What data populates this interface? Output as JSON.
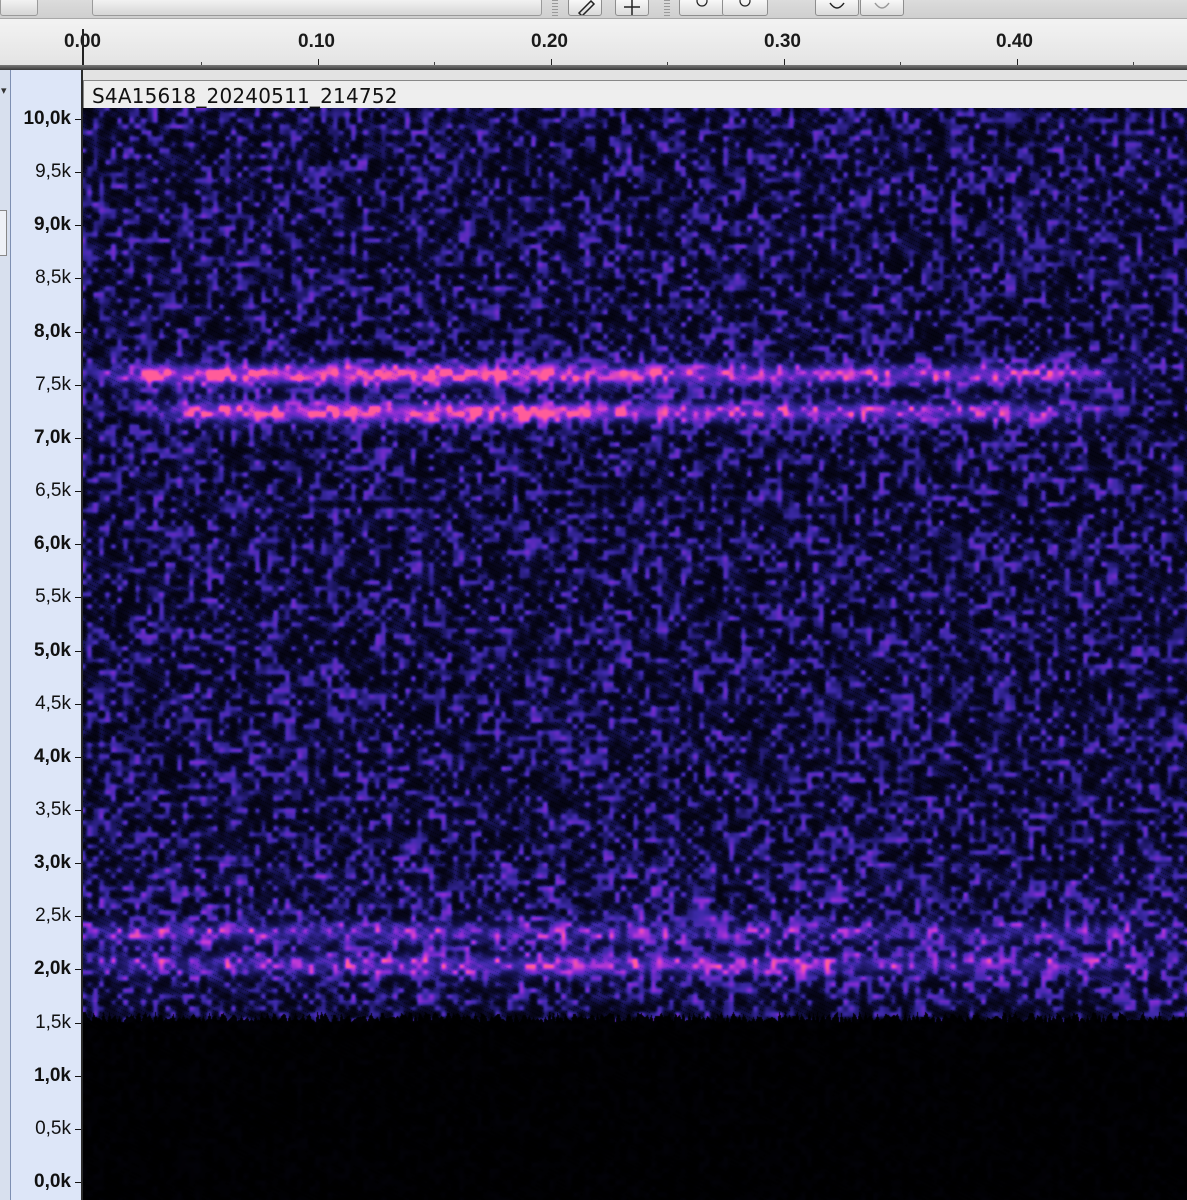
{
  "app": {
    "track_name": "S4A15618_20240511_214752"
  },
  "toolbar": {
    "icons": [
      "draw-tool-icon",
      "multi-tool-icon",
      "zoom-in-icon",
      "zoom-out-icon",
      "undo-icon",
      "redo-icon"
    ]
  },
  "timeline": {
    "ticks": [
      "0.00",
      "0.10",
      "0.20",
      "0.30",
      "0.40"
    ]
  },
  "frequency_axis": {
    "labels": [
      "10,0k",
      "9,5k",
      "9,0k",
      "8,5k",
      "8,0k",
      "7,5k",
      "7,0k",
      "6,5k",
      "6,0k",
      "5,5k",
      "5,0k",
      "4,5k",
      "4,0k",
      "3,5k",
      "3,0k",
      "2,5k",
      "2,0k",
      "1,5k",
      "1,0k",
      "0,5k",
      "0,0k"
    ]
  },
  "spectrogram": {
    "time_range_s": [
      0.0,
      0.475
    ],
    "freq_range_hz": [
      0,
      10000
    ],
    "colormap": [
      "#000000",
      "#14124f",
      "#3c2aa8",
      "#7a2bd0",
      "#c33ad6",
      "#ff5c9a"
    ],
    "noise_floor_cutoff_hz": 1500,
    "bands": [
      {
        "freq_hz": 7600,
        "t_start": 0.01,
        "t_end": 0.455,
        "peak_t": 0.12,
        "strength": 1.0
      },
      {
        "freq_hz": 7250,
        "t_start": 0.03,
        "t_end": 0.44,
        "peak_t": 0.13,
        "strength": 0.95
      },
      {
        "freq_hz": 2050,
        "t_start": 0.0,
        "t_end": 0.475,
        "peak_t": 0.2,
        "strength": 0.55
      },
      {
        "freq_hz": 2350,
        "t_start": 0.0,
        "t_end": 0.475,
        "peak_t": 0.1,
        "strength": 0.45
      }
    ]
  }
}
